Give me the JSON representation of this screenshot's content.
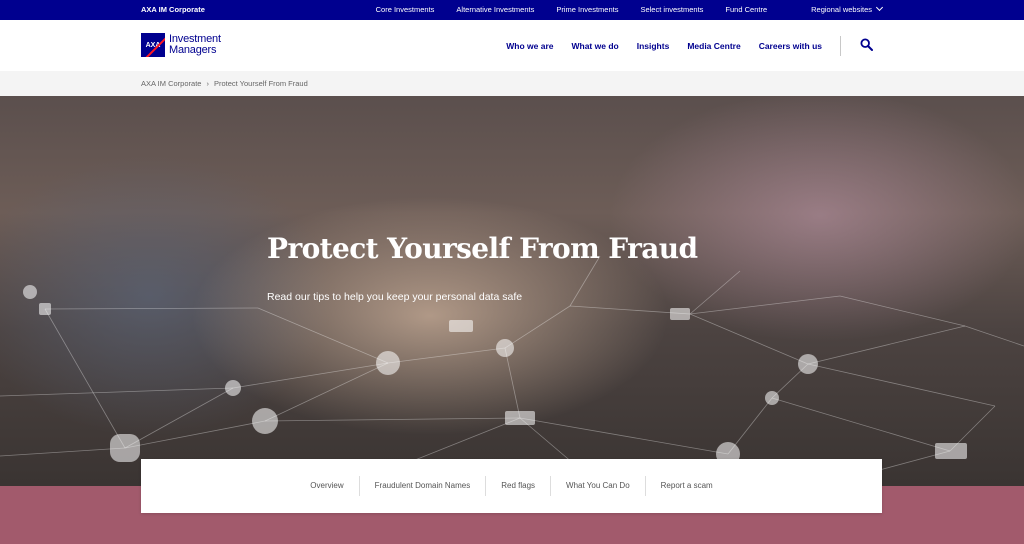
{
  "topbar": {
    "brand": "AXA IM Corporate",
    "links": [
      "Core Investments",
      "Alternative Investments",
      "Prime Investments",
      "Select investments",
      "Fund Centre",
      "Regional websites"
    ]
  },
  "header": {
    "logo_mark": "AXA",
    "logo_line1": "Investment",
    "logo_line2": "Managers",
    "nav": [
      "Who we are",
      "What we do",
      "Insights",
      "Media Centre",
      "Careers with us"
    ],
    "search_icon": "search-icon"
  },
  "breadcrumb": {
    "items": [
      "AXA IM Corporate",
      "Protect Yourself From Fraud"
    ],
    "separator": "›"
  },
  "hero": {
    "title": "Protect Yourself From Fraud",
    "subtitle": "Read our tips to help you keep your personal data safe"
  },
  "tabs": [
    "Overview",
    "Fraudulent Domain Names",
    "Red flags",
    "What You Can Do",
    "Report a scam"
  ],
  "colors": {
    "brand_blue": "#00008f",
    "band": "#a25a6c",
    "axa_red": "#ff1721"
  }
}
